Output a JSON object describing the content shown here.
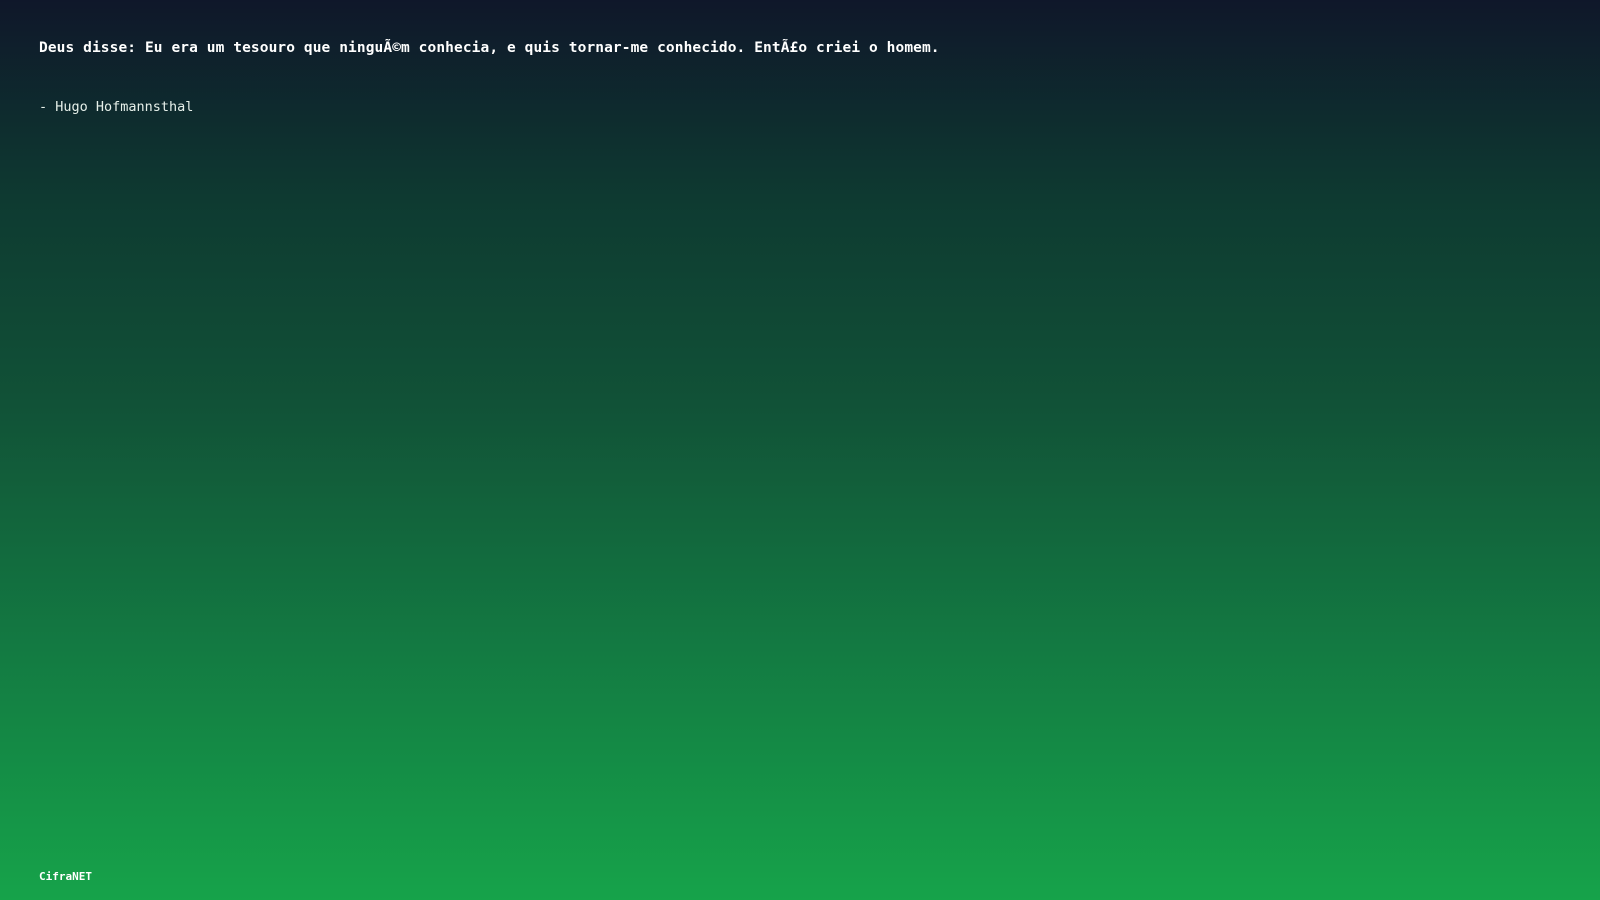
{
  "quote": {
    "text": "Deus disse: Eu era um tesouro que ninguÃ©m conhecia, e quis tornar-me conhecido. EntÃ£o criei o homem.",
    "author": "- Hugo Hofmannsthal"
  },
  "footer": {
    "brand": "CifraNET"
  }
}
